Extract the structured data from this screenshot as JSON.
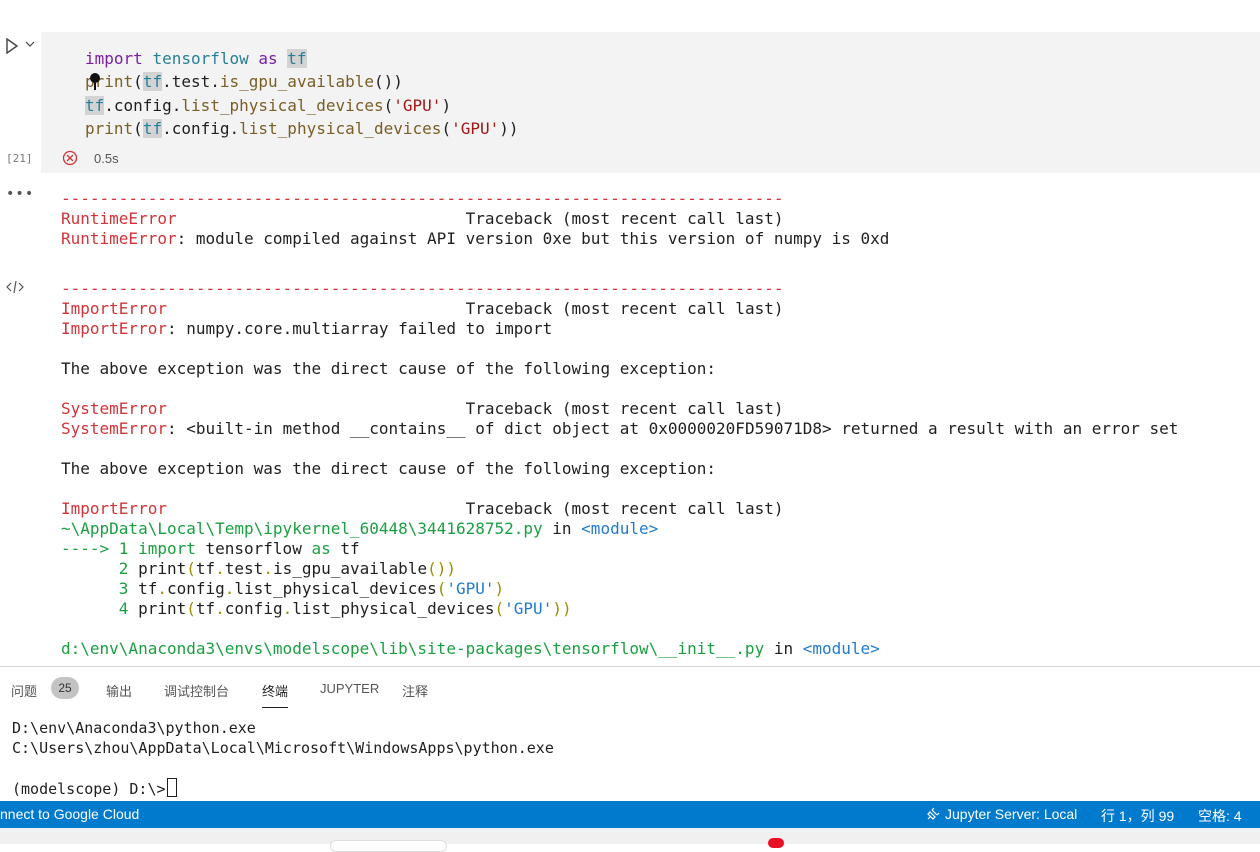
{
  "cell": {
    "code_lines": [
      {
        "segments": [
          {
            "t": "import",
            "c": "kw"
          },
          {
            "t": " ",
            "c": "plain"
          },
          {
            "t": "tensorflow",
            "c": "mod"
          },
          {
            "t": " as ",
            "c": "kw"
          },
          {
            "t": "tf",
            "c": "mod hl"
          }
        ]
      },
      {
        "segments": [
          {
            "t": "print",
            "c": "fn"
          },
          {
            "t": "(",
            "c": "plain"
          },
          {
            "t": "tf",
            "c": "mod hl"
          },
          {
            "t": ".test.",
            "c": "plain"
          },
          {
            "t": "is_gpu_available",
            "c": "fn"
          },
          {
            "t": "())",
            "c": "plain"
          }
        ]
      },
      {
        "segments": [
          {
            "t": "tf",
            "c": "mod hl"
          },
          {
            "t": ".config.",
            "c": "plain"
          },
          {
            "t": "list_physical_devices",
            "c": "fn"
          },
          {
            "t": "(",
            "c": "plain"
          },
          {
            "t": "'GPU'",
            "c": "str"
          },
          {
            "t": ")",
            "c": "plain"
          }
        ]
      },
      {
        "segments": [
          {
            "t": "print",
            "c": "fn"
          },
          {
            "t": "(",
            "c": "plain"
          },
          {
            "t": "tf",
            "c": "mod hl"
          },
          {
            "t": ".config.",
            "c": "plain"
          },
          {
            "t": "list_physical_devices",
            "c": "fn"
          },
          {
            "t": "(",
            "c": "plain"
          },
          {
            "t": "'GPU'",
            "c": "str"
          },
          {
            "t": "))",
            "c": "plain"
          }
        ]
      }
    ],
    "exec_count": "[21]",
    "duration": "0.5s"
  },
  "output": {
    "lines": [
      {
        "segments": [
          {
            "t": "---------------------------------------------------------------------------",
            "c": "red"
          }
        ]
      },
      {
        "segments": [
          {
            "t": "RuntimeError",
            "c": "red"
          },
          {
            "t": "                              Traceback (most recent call last)",
            "c": "plain"
          }
        ]
      },
      {
        "segments": [
          {
            "t": "RuntimeError",
            "c": "red"
          },
          {
            "t": ": module compiled against API version 0xe but this version of numpy is 0xd",
            "c": "plain"
          }
        ]
      },
      {
        "segments": []
      },
      {
        "segments": []
      },
      {
        "segments": [
          {
            "t": "---------------------------------------------------------------------------",
            "c": "red"
          }
        ]
      },
      {
        "segments": [
          {
            "t": "ImportError",
            "c": "red"
          },
          {
            "t": "                               Traceback (most recent call last)",
            "c": "plain"
          }
        ]
      },
      {
        "segments": [
          {
            "t": "ImportError",
            "c": "red"
          },
          {
            "t": ": numpy.core.multiarray failed to import",
            "c": "plain"
          }
        ]
      },
      {
        "segments": []
      },
      {
        "segments": [
          {
            "t": "The above exception was the direct cause of the following exception:",
            "c": "plain"
          }
        ]
      },
      {
        "segments": []
      },
      {
        "segments": [
          {
            "t": "SystemError",
            "c": "red"
          },
          {
            "t": "                               Traceback (most recent call last)",
            "c": "plain"
          }
        ]
      },
      {
        "segments": [
          {
            "t": "SystemError",
            "c": "red"
          },
          {
            "t": ": <built-in method __contains__ of dict object at 0x0000020FD59071D8> returned a result with an error set",
            "c": "plain"
          }
        ]
      },
      {
        "segments": []
      },
      {
        "segments": [
          {
            "t": "The above exception was the direct cause of the following exception:",
            "c": "plain"
          }
        ]
      },
      {
        "segments": []
      },
      {
        "segments": [
          {
            "t": "ImportError",
            "c": "red"
          },
          {
            "t": "                               Traceback (most recent call last)",
            "c": "plain"
          }
        ]
      },
      {
        "segments": [
          {
            "t": "~\\AppData\\Local\\Temp\\ipykernel_60448\\3441628752.py",
            "c": "green"
          },
          {
            "t": " in ",
            "c": "plain"
          },
          {
            "t": "<module>",
            "c": "blue"
          }
        ]
      },
      {
        "segments": [
          {
            "t": "----> 1 ",
            "c": "green"
          },
          {
            "t": "import",
            "c": "green"
          },
          {
            "t": " tensorflow ",
            "c": "plain"
          },
          {
            "t": "as",
            "c": "green"
          },
          {
            "t": " tf",
            "c": "plain"
          }
        ]
      },
      {
        "segments": [
          {
            "t": "      2 ",
            "c": "green"
          },
          {
            "t": "print",
            "c": "plain"
          },
          {
            "t": "(",
            "c": "ol"
          },
          {
            "t": "tf",
            "c": "plain"
          },
          {
            "t": ".",
            "c": "ol"
          },
          {
            "t": "test",
            "c": "plain"
          },
          {
            "t": ".",
            "c": "ol"
          },
          {
            "t": "is_gpu_available",
            "c": "plain"
          },
          {
            "t": "())",
            "c": "ol"
          }
        ]
      },
      {
        "segments": [
          {
            "t": "      3 ",
            "c": "green"
          },
          {
            "t": "tf",
            "c": "plain"
          },
          {
            "t": ".",
            "c": "ol"
          },
          {
            "t": "config",
            "c": "plain"
          },
          {
            "t": ".",
            "c": "ol"
          },
          {
            "t": "list_physical_devices",
            "c": "plain"
          },
          {
            "t": "(",
            "c": "ol"
          },
          {
            "t": "'GPU'",
            "c": "blue"
          },
          {
            "t": ")",
            "c": "ol"
          }
        ]
      },
      {
        "segments": [
          {
            "t": "      4 ",
            "c": "green"
          },
          {
            "t": "print",
            "c": "plain"
          },
          {
            "t": "(",
            "c": "ol"
          },
          {
            "t": "tf",
            "c": "plain"
          },
          {
            "t": ".",
            "c": "ol"
          },
          {
            "t": "config",
            "c": "plain"
          },
          {
            "t": ".",
            "c": "ol"
          },
          {
            "t": "list_physical_devices",
            "c": "plain"
          },
          {
            "t": "(",
            "c": "ol"
          },
          {
            "t": "'GPU'",
            "c": "blue"
          },
          {
            "t": "))",
            "c": "ol"
          }
        ]
      },
      {
        "segments": []
      },
      {
        "segments": [
          {
            "t": "d:\\env\\Anaconda3\\envs\\modelscope\\lib\\site-packages\\tensorflow\\__init__.py",
            "c": "green"
          },
          {
            "t": " in ",
            "c": "plain"
          },
          {
            "t": "<module>",
            "c": "blue"
          }
        ]
      }
    ]
  },
  "panel": {
    "tabs": [
      {
        "label": "问题",
        "active": false
      },
      {
        "label": "输出",
        "active": false
      },
      {
        "label": "调试控制台",
        "active": false
      },
      {
        "label": "终端",
        "active": true
      },
      {
        "label": "JUPYTER",
        "active": false
      },
      {
        "label": "注释",
        "active": false
      }
    ],
    "problems_count": "25",
    "terminal_lines": [
      "D:\\env\\Anaconda3\\python.exe",
      "C:\\Users\\zhou\\AppData\\Local\\Microsoft\\WindowsApps\\python.exe",
      ""
    ],
    "prompt": "(modelscope) D:\\>"
  },
  "statusbar": {
    "left": "nnect to Google Cloud",
    "jupyter": "Jupyter Server: Local",
    "position": "行 1，列 99",
    "spaces": "空格: 4"
  }
}
